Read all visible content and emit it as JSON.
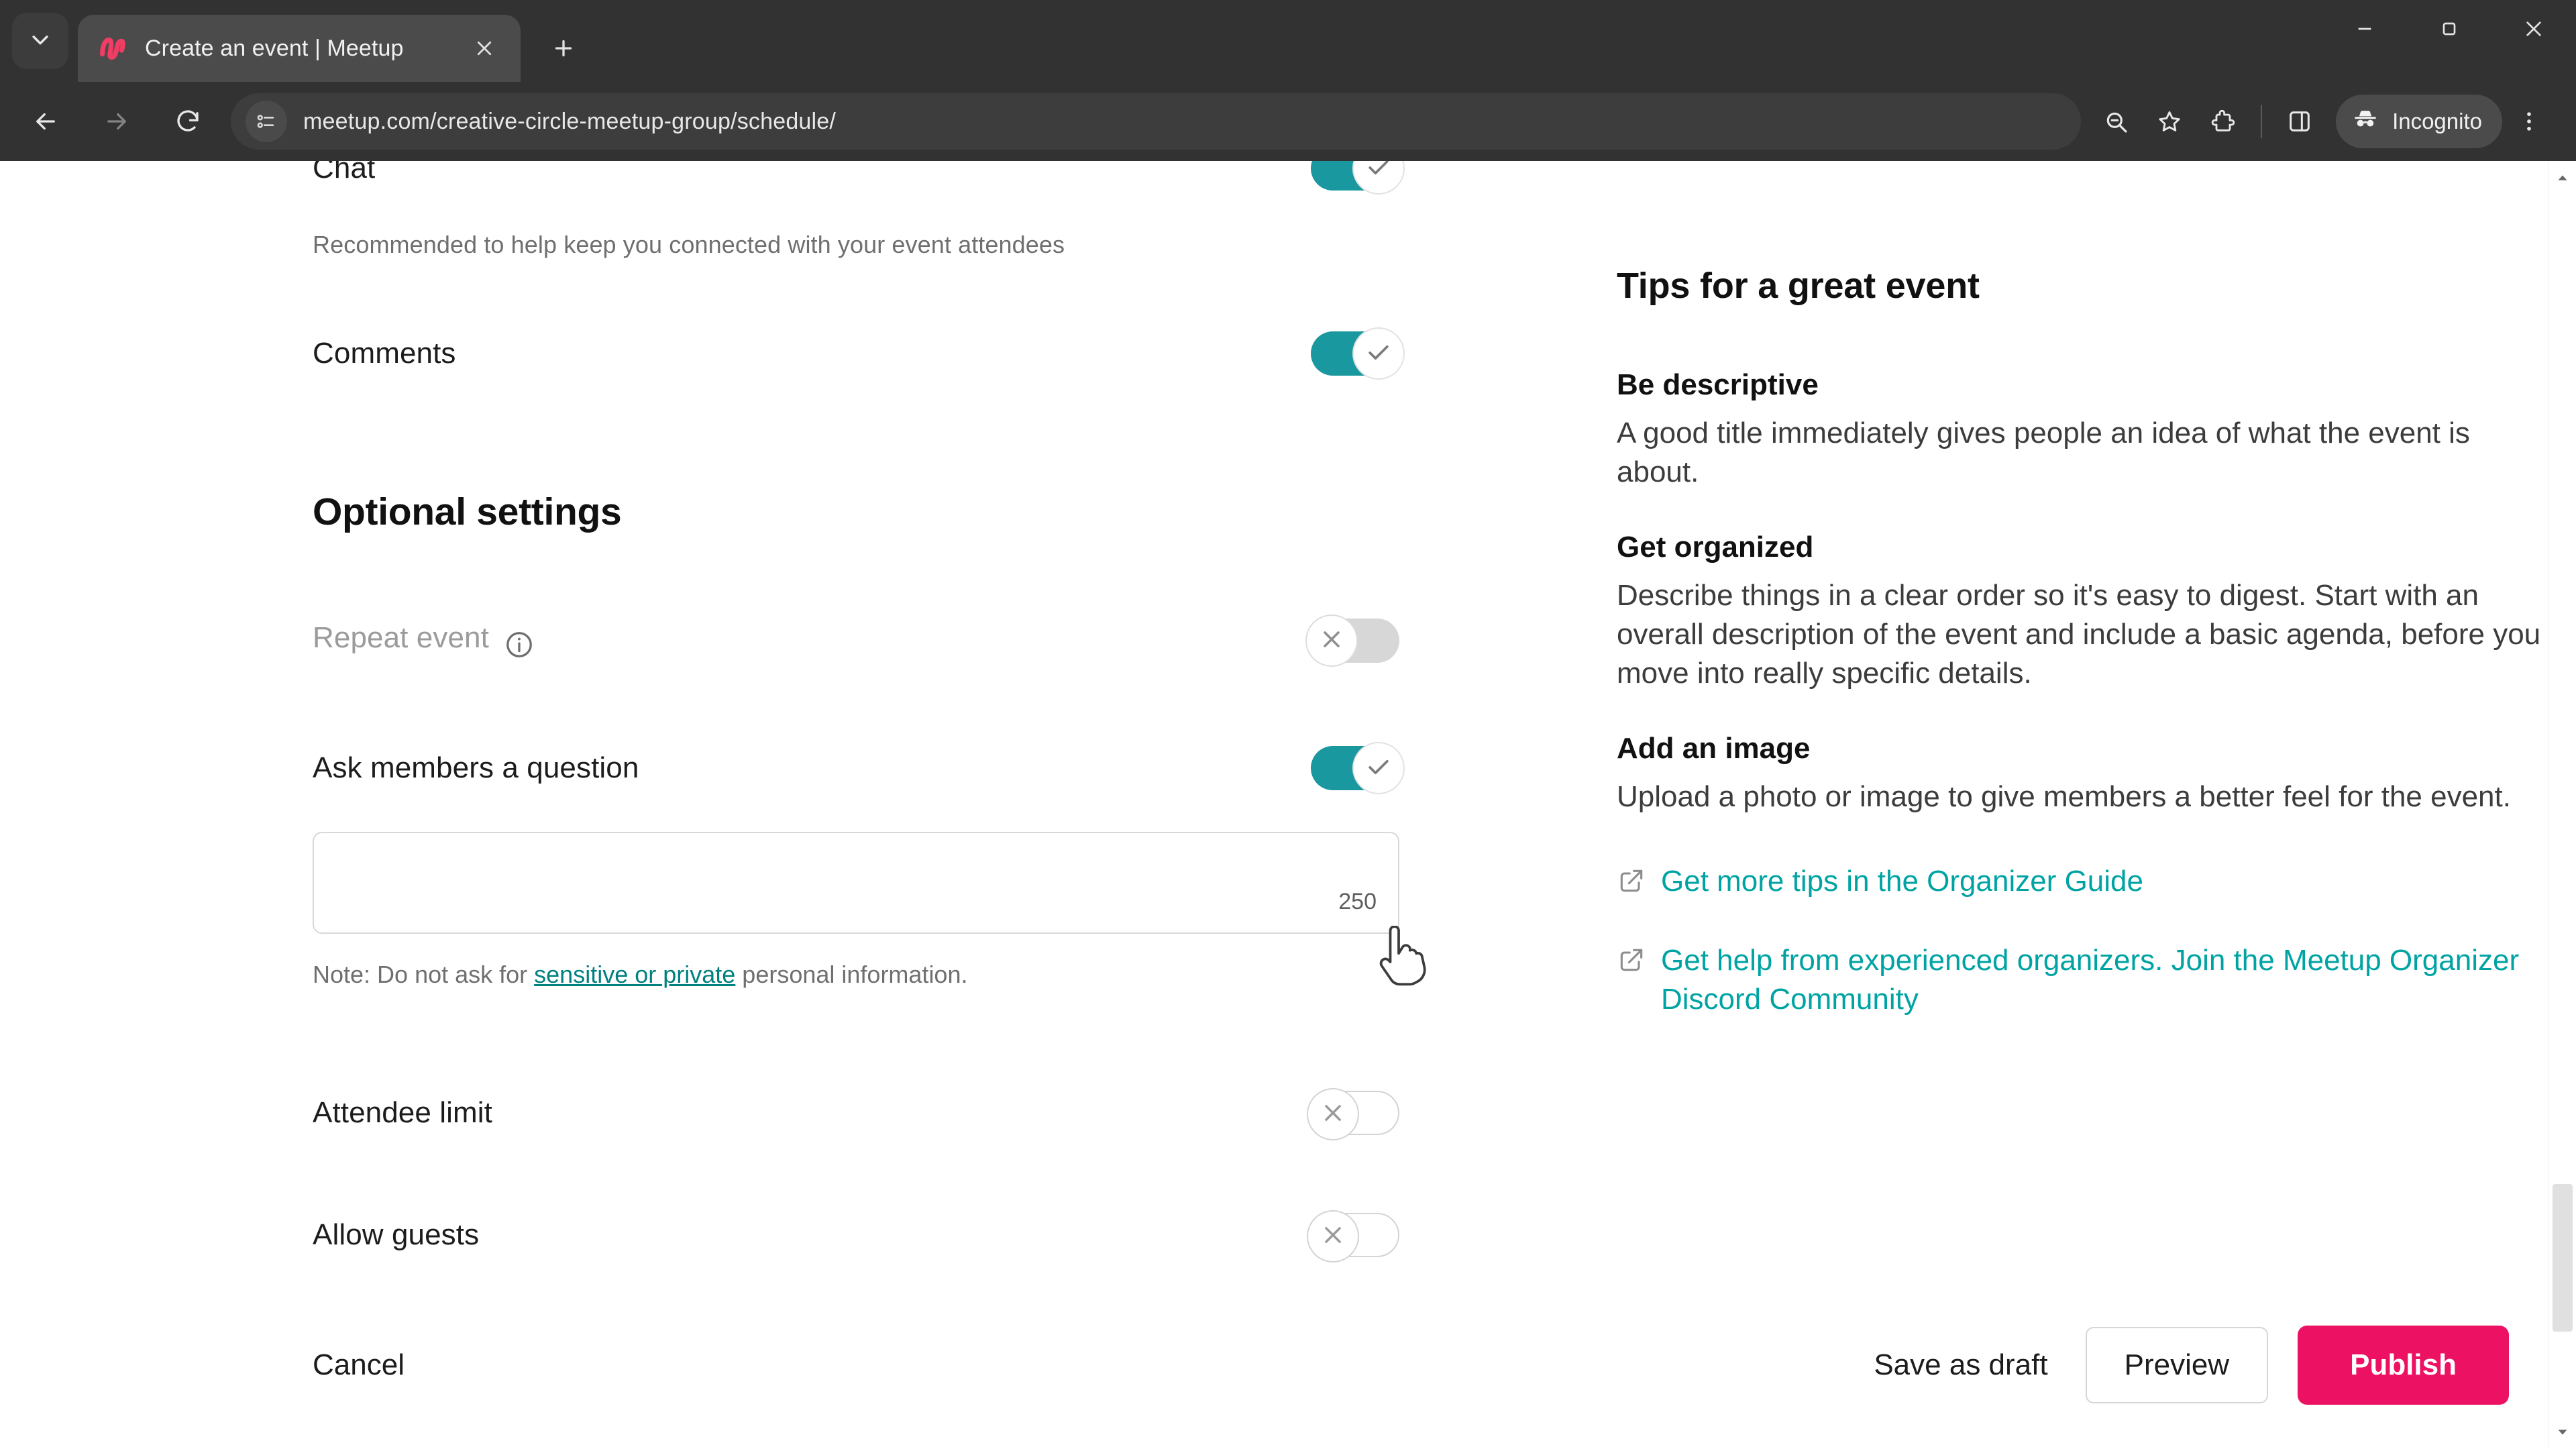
{
  "browser": {
    "tab": {
      "title": "Create an event | Meetup",
      "favicon": "meetup-logo-icon"
    },
    "new_tab_label": "+",
    "url": "meetup.com/creative-circle-meetup-group/schedule/",
    "profile_label": "Incognito",
    "icons": {
      "tab_list": "chevron-down-icon",
      "close": "close-icon",
      "back": "back-arrow-icon",
      "forward": "forward-arrow-icon",
      "reload": "reload-icon",
      "site_info": "page-info-icon",
      "zoom": "zoom-out-icon",
      "bookmark": "star-icon",
      "extensions": "extensions-icon",
      "side_panel": "side-panel-icon",
      "menu": "three-dot-menu-icon",
      "minimize": "minimize-icon",
      "maximize": "maximize-icon",
      "window_close": "window-close-icon"
    }
  },
  "form": {
    "chat": {
      "label": "Chat",
      "helper": "Recommended to help keep you connected with your event attendees",
      "state": "on"
    },
    "comments": {
      "label": "Comments",
      "state": "on"
    },
    "optional_settings_title": "Optional settings",
    "repeat_event": {
      "label": "Repeat event",
      "state": "off",
      "disabled": true,
      "info_icon": "info-icon"
    },
    "ask_question": {
      "label": "Ask members a question",
      "state": "on",
      "value": "",
      "char_count": "250",
      "note_prefix": "Note: Do not ask for ",
      "note_link": "sensitive or private",
      "note_suffix": " personal information."
    },
    "attendee_limit": {
      "label": "Attendee limit",
      "state": "off"
    },
    "allow_guests": {
      "label": "Allow guests",
      "state": "off"
    }
  },
  "tips": {
    "title": "Tips for a great event",
    "items": [
      {
        "heading": "Be descriptive",
        "body": "A good title immediately gives people an idea of what the event is about."
      },
      {
        "heading": "Get organized",
        "body": "Describe things in a clear order so it's easy to digest. Start with an overall description of the event and include a basic agenda, before you move into really specific details."
      },
      {
        "heading": "Add an image",
        "body": "Upload a photo or image to give members a better feel for the event."
      }
    ],
    "links": [
      {
        "text": "Get more tips in the Organizer Guide",
        "icon": "external-link-icon"
      },
      {
        "text": "Get help from experienced organizers. Join the Meetup Organizer Discord Community",
        "icon": "external-link-icon"
      }
    ]
  },
  "footer": {
    "cancel": "Cancel",
    "save_draft": "Save as draft",
    "preview": "Preview",
    "publish": "Publish"
  },
  "colors": {
    "accent_teal": "#1a989f",
    "link_teal": "#00a3a3",
    "publish_pink": "#ED1164"
  }
}
